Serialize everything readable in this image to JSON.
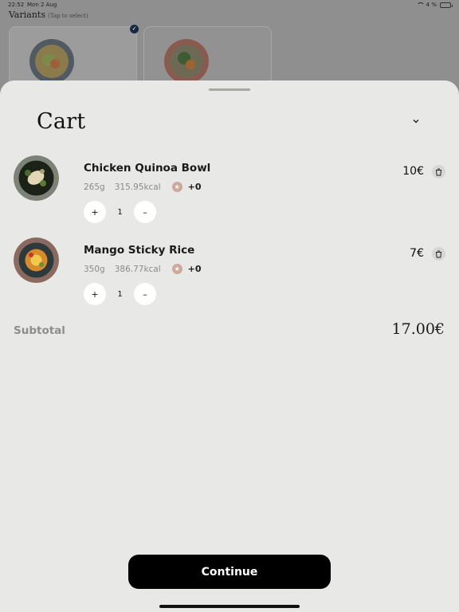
{
  "status_bar": {
    "time": "22:52",
    "date": "Mon 2 Aug",
    "battery": "4 %"
  },
  "background": {
    "title": "Variants",
    "hint": "(Tap to select)"
  },
  "cart": {
    "title": "Cart",
    "items": [
      {
        "name": "Chicken Quinoa Bowl",
        "weight": "265g",
        "kcal": "315.95kcal",
        "points": "+0",
        "quantity": "1",
        "price": "10€",
        "plus": "+",
        "minus": "–"
      },
      {
        "name": "Mango Sticky Rice",
        "weight": "350g",
        "kcal": "386.77kcal",
        "points": "+0",
        "quantity": "1",
        "price": "7€",
        "plus": "+",
        "minus": "–"
      }
    ],
    "subtotal_label": "Subtotal",
    "subtotal_value": "17.00€",
    "continue_label": "Continue"
  },
  "icons": {
    "collapse": "chevron-down-icon",
    "delete": "trash-icon",
    "star": "star-icon",
    "check": "check-icon"
  },
  "colors": {
    "sheet_bg": "#e8e8e6",
    "button_bg": "#000000",
    "star_badge": "#cfa89c",
    "check_badge": "#162a44"
  }
}
